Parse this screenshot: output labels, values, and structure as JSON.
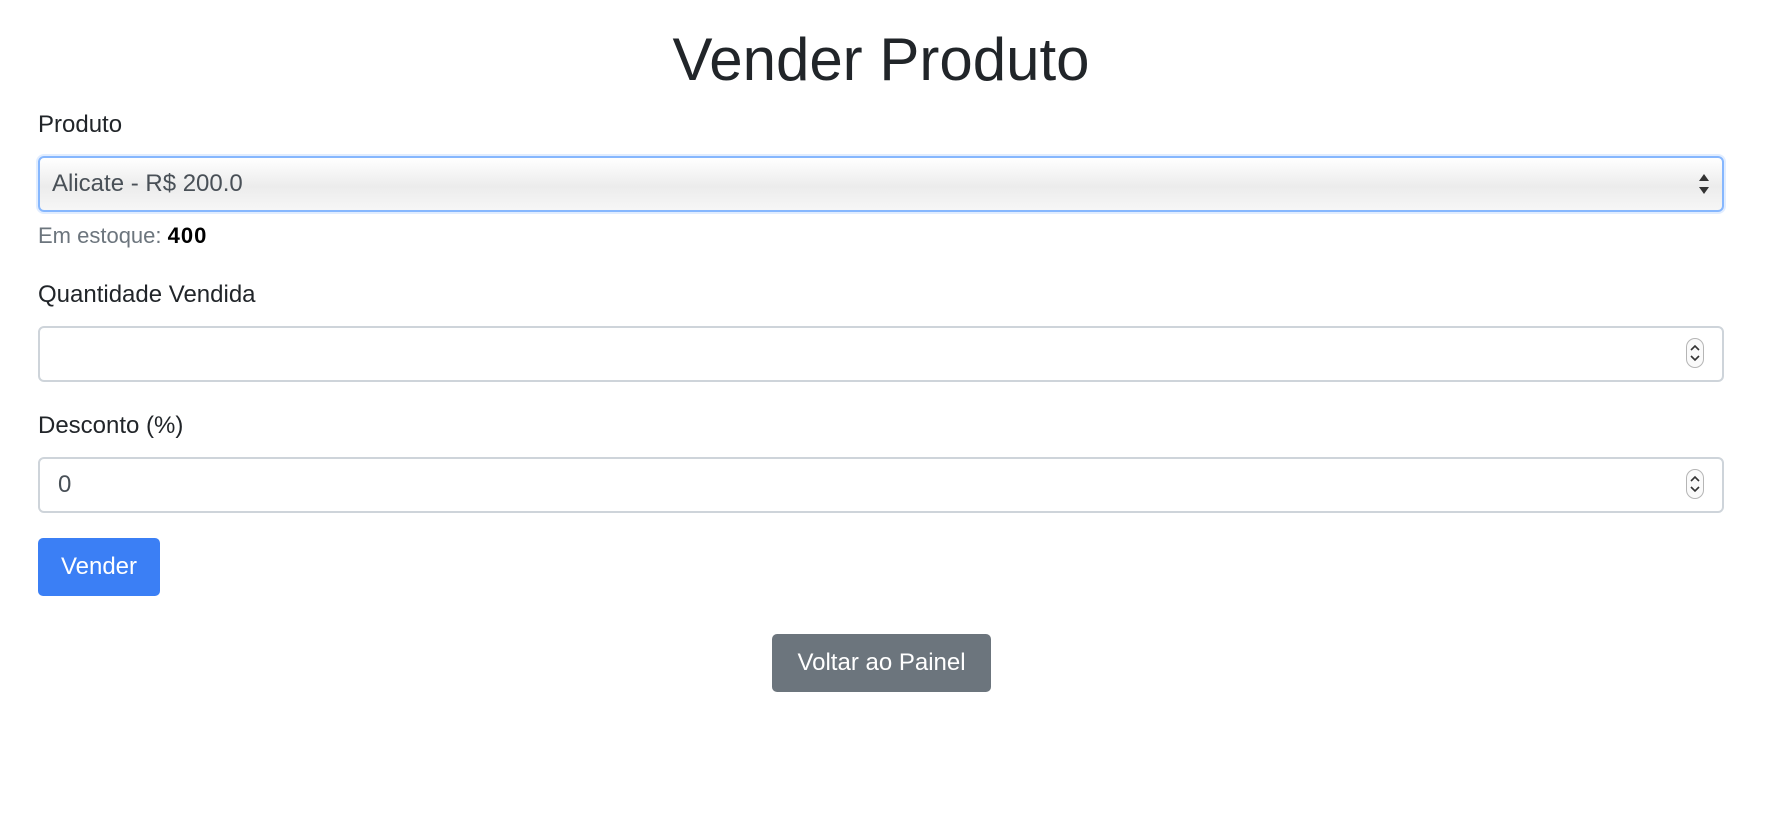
{
  "page": {
    "title": "Vender Produto"
  },
  "form": {
    "product": {
      "label": "Produto",
      "selected": "Alicate - R$ 200.0"
    },
    "stock": {
      "label": "Em estoque:",
      "value": "400"
    },
    "quantity": {
      "label": "Quantidade Vendida",
      "value": ""
    },
    "discount": {
      "label": "Desconto (%)",
      "value": "0"
    },
    "submit_label": "Vender"
  },
  "footer": {
    "back_label": "Voltar ao Painel"
  },
  "colors": {
    "primary": "#3b7ff5",
    "secondary": "#6c757d",
    "focus_border": "#86b7fe",
    "muted_text": "#6c757d"
  }
}
